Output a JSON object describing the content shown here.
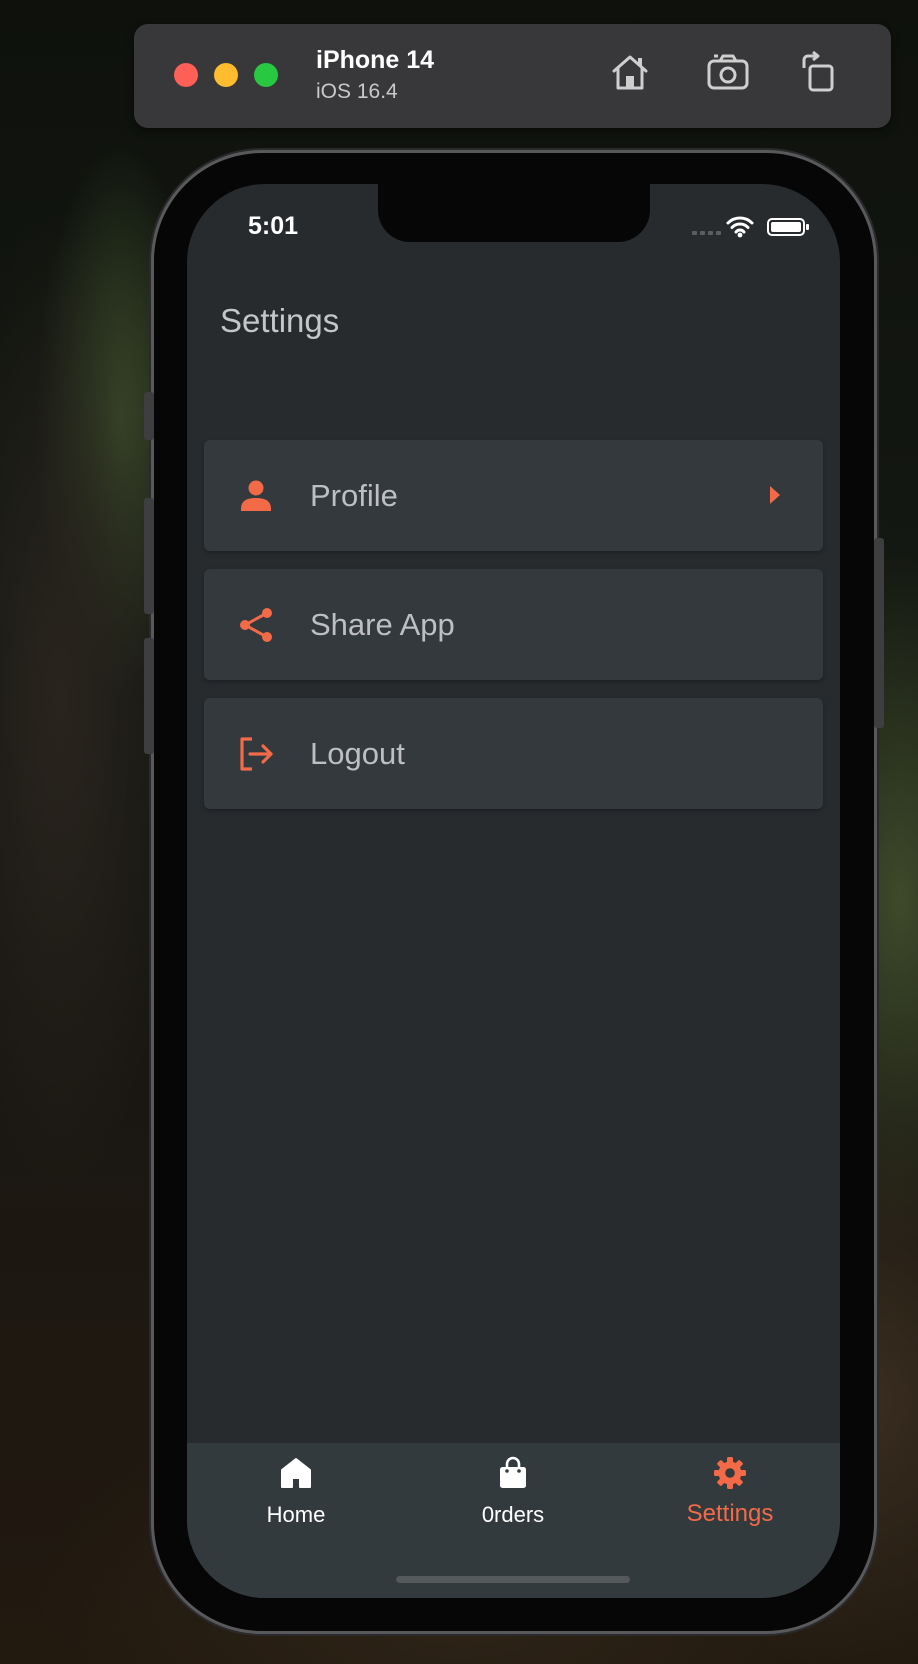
{
  "simulator": {
    "device_name": "iPhone 14",
    "os_version": "iOS 16.4",
    "icons": [
      "home-icon",
      "screenshot-icon",
      "rotate-icon"
    ]
  },
  "status_bar": {
    "time": "5:01",
    "icons": [
      "signal-icon",
      "wifi-icon",
      "battery-icon"
    ]
  },
  "header": {
    "title": "Settings"
  },
  "menu": {
    "items": [
      {
        "label": "Profile",
        "icon": "person-icon",
        "has_chevron": true
      },
      {
        "label": "Share App",
        "icon": "share-icon",
        "has_chevron": false
      },
      {
        "label": "Logout",
        "icon": "logout-icon",
        "has_chevron": false
      }
    ]
  },
  "tabbar": {
    "tabs": [
      {
        "label": "Home",
        "icon": "home-icon",
        "active": false
      },
      {
        "label": "0rders",
        "icon": "shopping-bag-icon",
        "active": false
      },
      {
        "label": "Settings",
        "icon": "gear-icon",
        "active": true
      }
    ]
  },
  "colors": {
    "accent": "#f26a47",
    "screen_background": "#272b2e",
    "card_background": "#33393d",
    "tabbar_background": "#333a3e"
  }
}
